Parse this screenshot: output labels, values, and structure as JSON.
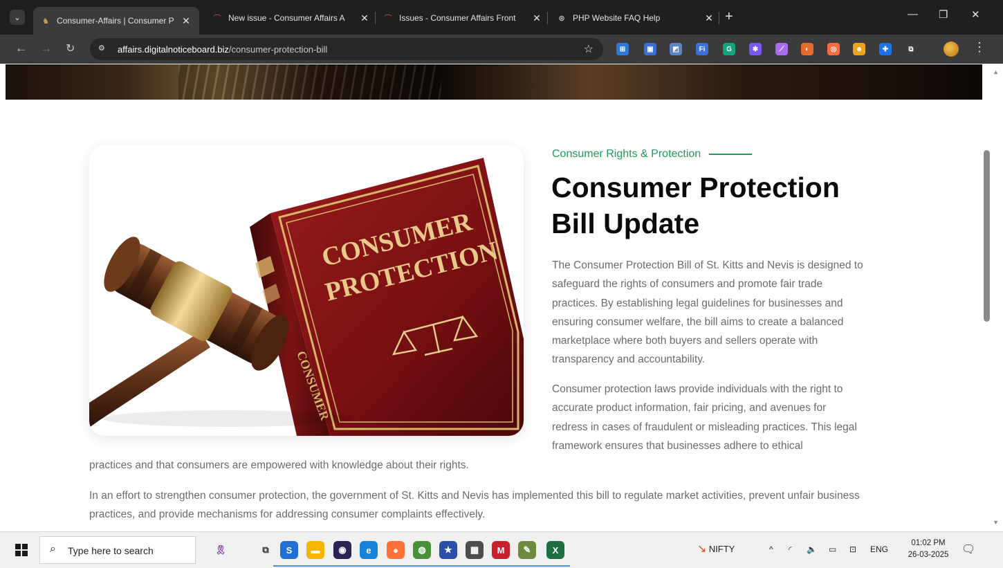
{
  "browser": {
    "tabs": [
      {
        "title": "Consumer-Affairs | Consumer P",
        "active": true
      },
      {
        "title": "New issue - Consumer Affairs A",
        "active": false
      },
      {
        "title": "Issues - Consumer Affairs Front",
        "active": false
      },
      {
        "title": "PHP Website FAQ Help",
        "active": false
      }
    ],
    "close_glyph": "✕",
    "new_tab_glyph": "+",
    "url_host": "affairs.digitalnoticeboard.biz",
    "url_path": "/consumer-protection-bill",
    "extensions": [
      {
        "icon": "extension-outlook-icon",
        "label": "⊞",
        "color": "#2d7bd6"
      },
      {
        "icon": "extension-screen-icon",
        "label": "▣",
        "color": "#3a6fd8"
      },
      {
        "icon": "extension-tabs-icon",
        "label": "◩",
        "color": "#5c84c6"
      },
      {
        "icon": "extension-fi-icon",
        "label": "Fi",
        "color": "#3f6fd9"
      },
      {
        "icon": "extension-grammarly-icon",
        "label": "G",
        "color": "#15a37e"
      },
      {
        "icon": "extension-spark-icon",
        "label": "✱",
        "color": "#7a5af5"
      },
      {
        "icon": "extension-feather-icon",
        "label": "⟋",
        "color": "#a86bf2"
      },
      {
        "icon": "extension-swirl-icon",
        "label": "◐",
        "color": "#e86b2d"
      },
      {
        "icon": "extension-ring-icon",
        "label": "◎",
        "color": "#ff6a3d"
      },
      {
        "icon": "extension-face-icon",
        "label": "☻",
        "color": "#f0a21b"
      },
      {
        "icon": "extension-puzzle-blue-icon",
        "label": "✚",
        "color": "#1a73e8"
      },
      {
        "icon": "extensions-menu-icon",
        "label": "⧉",
        "color": "#3b3b3b"
      }
    ]
  },
  "page": {
    "eyebrow": "Consumer Rights & Protection",
    "headline": "Consumer Protection Bill Update",
    "paragraph1": "The Consumer Protection Bill of St. Kitts and Nevis is designed to safeguard the rights of consumers and promote fair trade practices. By establishing legal guidelines for businesses and ensuring consumer welfare, the bill aims to create a balanced marketplace where both buyers and sellers operate with transparency and accountability.",
    "paragraph2_wrapped": "Consumer protection laws provide individuals with the right to accurate product information, fair pricing, and avenues for redress in cases of fraudulent or misleading practices. This legal framework ensures that businesses adhere to ethical",
    "paragraph2_tail": "practices and that consumers are empowered with knowledge about their rights.",
    "paragraph3": "In an effort to strengthen consumer protection, the government of St. Kitts and Nevis has implemented this bill to regulate market activities, prevent unfair business practices, and provide mechanisms for addressing consumer complaints effectively.",
    "book_line1": "CONSUMER",
    "book_line2": "PROTECTION",
    "book_spine": "CONSUMER",
    "colors": {
      "accent_green": "#1e9a58",
      "book_red": "#7d0f12",
      "gold": "#d9b56a"
    }
  },
  "taskbar": {
    "search_placeholder": "Type here to search",
    "apps": [
      {
        "icon": "awareness-ribbon-icon",
        "label": "🎗"
      },
      {
        "icon": "task-view-icon",
        "label": "⧉"
      },
      {
        "icon": "skype-icon",
        "label": "S"
      },
      {
        "icon": "file-explorer-icon",
        "label": "▬"
      },
      {
        "icon": "eclipse-icon",
        "label": "◉"
      },
      {
        "icon": "edge-icon",
        "label": "e"
      },
      {
        "icon": "firefox-icon",
        "label": "●"
      },
      {
        "icon": "chrome-icon",
        "label": "◍"
      },
      {
        "icon": "app-star-icon",
        "label": "★"
      },
      {
        "icon": "calculator-icon",
        "label": "▦"
      },
      {
        "icon": "mcafee-icon",
        "label": "M"
      },
      {
        "icon": "notepad-icon",
        "label": "✎"
      },
      {
        "icon": "excel-icon",
        "label": "X"
      }
    ],
    "nifty_label": "NIFTY",
    "lang": "ENG",
    "time": "01:02 PM",
    "date": "26-03-2025"
  }
}
